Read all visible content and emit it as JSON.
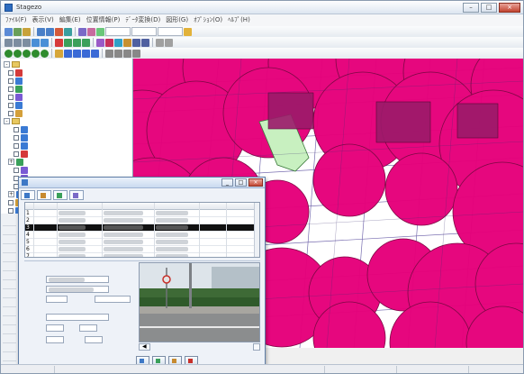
{
  "window": {
    "title": "Stagezo",
    "minimize": "–",
    "maximize": "□",
    "close": "×"
  },
  "menubar": [
    {
      "label": "ﾌｧｲﾙ(F)"
    },
    {
      "label": "表示(V)"
    },
    {
      "label": "編集(E)"
    },
    {
      "label": "位置情報(P)"
    },
    {
      "label": "ﾃﾞｰﾀ変換(D)"
    },
    {
      "label": "図形(G)"
    },
    {
      "label": "ｵﾌﾟｼｮﾝ(O)"
    },
    {
      "label": "ﾍﾙﾌﾟ(H)"
    }
  ],
  "toolbar": {
    "scale_box": "",
    "layer_box": "",
    "view_box": ""
  },
  "tree": {
    "items": [
      {
        "label": ""
      },
      {
        "label": ""
      },
      {
        "label": ""
      },
      {
        "label": ""
      },
      {
        "label": ""
      },
      {
        "label": ""
      },
      {
        "label": ""
      },
      {
        "label": ""
      },
      {
        "label": ""
      },
      {
        "label": ""
      },
      {
        "label": ""
      },
      {
        "label": ""
      },
      {
        "label": ""
      },
      {
        "label": ""
      },
      {
        "label": ""
      },
      {
        "label": ""
      },
      {
        "label": ""
      },
      {
        "label": ""
      },
      {
        "label": ""
      },
      {
        "label": ""
      }
    ]
  },
  "dialog": {
    "title": "",
    "min": "_",
    "max": "□",
    "close": "×",
    "tabs": [
      {
        "label": ""
      },
      {
        "label": ""
      },
      {
        "label": ""
      },
      {
        "label": ""
      }
    ],
    "grid": {
      "columns": [
        "",
        "",
        "",
        "",
        "",
        "",
        ""
      ],
      "rows": [
        {
          "no": "1",
          "type": "",
          "status": "",
          "mark": ""
        },
        {
          "no": "2",
          "type": "",
          "status": "",
          "mark": ""
        },
        {
          "no": "3",
          "type": "",
          "status": "",
          "mark": ""
        },
        {
          "no": "4",
          "type": "",
          "status": "",
          "mark": ""
        },
        {
          "no": "5",
          "type": "",
          "status": "",
          "mark": ""
        },
        {
          "no": "6",
          "type": "",
          "status": "",
          "mark": ""
        },
        {
          "no": "7",
          "type": "",
          "status": "",
          "mark": ""
        }
      ]
    },
    "form": {
      "section_label": "",
      "field1_label": "",
      "field2_label": "",
      "field3_label": "",
      "field3_value": "",
      "field3b_label": "",
      "field3b_value": "",
      "field4_label": "",
      "field4_value": "",
      "field5_label": "",
      "field5_value": "",
      "field6_label": "",
      "field6_value": "",
      "field7_label": "",
      "field8_label": ""
    },
    "photo_counter": "",
    "photo_button": "",
    "footer": {
      "btn1": "",
      "btn2": "",
      "btn3": "",
      "btn4": ""
    }
  },
  "map_status": {
    "coords": "",
    "layer": "",
    "extra": ""
  },
  "statusbar": {
    "left": "",
    "mid": "",
    "right1": "",
    "right2": ""
  },
  "colors": {
    "buffer_fill": "#e6007a",
    "buffer_stroke": "#7a0040",
    "overlap_fill": "#9b1a6a",
    "parcel_green": "#c8f0c0",
    "road_line": "#6a5ea8",
    "window_blue": "#2d6cc0"
  }
}
